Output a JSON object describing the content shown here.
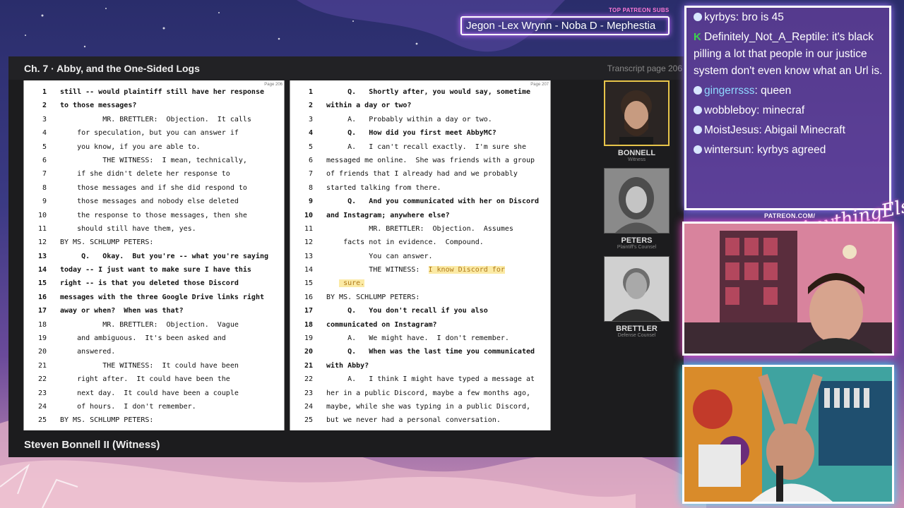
{
  "subs": {
    "label": "TOP PATREON SUBS",
    "names": "Jegon -Lex Wrynn -  Noba D - Mephestia"
  },
  "header": {
    "chapter": "Ch. 7  ·  Abby, and the One-Sided Logs",
    "transcript_page": "Transcript page 206"
  },
  "left_page": {
    "page_no": "Page 206",
    "lines": [
      {
        "n": "1",
        "t": "still -- would plaintiff still have her response",
        "b": true
      },
      {
        "n": "2",
        "t": "to those messages?",
        "b": true
      },
      {
        "n": "3",
        "t": "          MR. BRETTLER:  Objection.  It calls",
        "b": false
      },
      {
        "n": "4",
        "t": "    for speculation, but you can answer if",
        "b": false
      },
      {
        "n": "5",
        "t": "    you know, if you are able to.",
        "b": false
      },
      {
        "n": "6",
        "t": "          THE WITNESS:  I mean, technically,",
        "b": false
      },
      {
        "n": "7",
        "t": "    if she didn't delete her response to",
        "b": false
      },
      {
        "n": "8",
        "t": "    those messages and if she did respond to",
        "b": false
      },
      {
        "n": "9",
        "t": "    those messages and nobody else deleted",
        "b": false
      },
      {
        "n": "10",
        "t": "    the response to those messages, then she",
        "b": false
      },
      {
        "n": "11",
        "t": "    should still have them, yes.",
        "b": false
      },
      {
        "n": "12",
        "t": "BY MS. SCHLUMP PETERS:",
        "b": false
      },
      {
        "n": "13",
        "t": "     Q.   Okay.  But you're -- what you're saying",
        "b": true
      },
      {
        "n": "14",
        "t": "today -- I just want to make sure I have this",
        "b": true
      },
      {
        "n": "15",
        "t": "right -- is that you deleted those Discord",
        "b": true
      },
      {
        "n": "16",
        "t": "messages with the three Google Drive links right",
        "b": true
      },
      {
        "n": "17",
        "t": "away or when?  When was that?",
        "b": true
      },
      {
        "n": "18",
        "t": "          MR. BRETTLER:  Objection.  Vague",
        "b": false
      },
      {
        "n": "19",
        "t": "    and ambiguous.  It's been asked and",
        "b": false
      },
      {
        "n": "20",
        "t": "    answered.",
        "b": false
      },
      {
        "n": "21",
        "t": "          THE WITNESS:  It could have been",
        "b": false
      },
      {
        "n": "22",
        "t": "    right after.  It could have been the",
        "b": false
      },
      {
        "n": "23",
        "t": "    next day.  It could have been a couple",
        "b": false
      },
      {
        "n": "24",
        "t": "    of hours.  I don't remember.",
        "b": false
      },
      {
        "n": "25",
        "t": "BY MS. SCHLUMP PETERS:",
        "b": false
      }
    ]
  },
  "right_page": {
    "page_no": "Page 207",
    "lines": [
      {
        "n": "1",
        "t": "     Q.   Shortly after, you would say, sometime",
        "b": true
      },
      {
        "n": "2",
        "t": "within a day or two?",
        "b": true
      },
      {
        "n": "3",
        "t": "     A.   Probably within a day or two.",
        "b": false
      },
      {
        "n": "4",
        "t": "     Q.   How did you first meet AbbyMC?",
        "b": true
      },
      {
        "n": "5",
        "t": "     A.   I can't recall exactly.  I'm sure she",
        "b": false
      },
      {
        "n": "6",
        "t": "messaged me online.  She was friends with a group",
        "b": false
      },
      {
        "n": "7",
        "t": "of friends that I already had and we probably",
        "b": false
      },
      {
        "n": "8",
        "t": "started talking from there.",
        "b": false
      },
      {
        "n": "9",
        "t": "     Q.   And you communicated with her on Discord",
        "b": true
      },
      {
        "n": "10",
        "t": "and Instagram; anywhere else?",
        "b": true
      },
      {
        "n": "11",
        "t": "          MR. BRETTLER:  Objection.  Assumes",
        "b": false
      },
      {
        "n": "12",
        "t": "    facts not in evidence.  Compound.",
        "b": false
      },
      {
        "n": "13",
        "t": "          You can answer.",
        "b": false
      },
      {
        "n": "14",
        "t": "          THE WITNESS:  ",
        "b": false,
        "hl": "I know Discord for"
      },
      {
        "n": "15",
        "t": "   ",
        "b": false,
        "hl": " sure."
      },
      {
        "n": "16",
        "t": "BY MS. SCHLUMP PETERS:",
        "b": false
      },
      {
        "n": "17",
        "t": "     Q.   You don't recall if you also",
        "b": true
      },
      {
        "n": "18",
        "t": "communicated on Instagram?",
        "b": true
      },
      {
        "n": "19",
        "t": "     A.   We might have.  I don't remember.",
        "b": false
      },
      {
        "n": "20",
        "t": "     Q.   When was the last time you communicated",
        "b": true
      },
      {
        "n": "21",
        "t": "with Abby?",
        "b": true
      },
      {
        "n": "22",
        "t": "     A.   I think I might have typed a message at",
        "b": false
      },
      {
        "n": "23",
        "t": "her in a public Discord, maybe a few months ago,",
        "b": false
      },
      {
        "n": "24",
        "t": "maybe, while she was typing in a public Discord,",
        "b": false
      },
      {
        "n": "25",
        "t": "but we never had a personal conversation.",
        "b": false
      }
    ]
  },
  "people": [
    {
      "name": "BONNELL",
      "role": "Witness"
    },
    {
      "name": "PETERS",
      "role": "Plaintiff's Counsel"
    },
    {
      "name": "BRETTLER",
      "role": "Defense Counsel"
    }
  ],
  "footer": {
    "speaker": "Steven Bonnell II (Witness)"
  },
  "chat": [
    {
      "user": "kyrbys",
      "msg": " bro is 45",
      "badge": "dot"
    },
    {
      "user": "Definitely_Not_A_Reptile",
      "msg": " it's black pilling a lot that people in our justice system don't even know what an Url is.",
      "badge": "kick"
    },
    {
      "user": "gingerrsss",
      "msg": "  queen",
      "badge": "dot",
      "blue": true
    },
    {
      "user": "wobbleboy",
      "msg": " minecraf",
      "badge": "dot"
    },
    {
      "user": "MoistJesus",
      "msg": " Abigail Minecraft",
      "badge": "dot"
    },
    {
      "user": "wintersun",
      "msg": " kyrbys agreed",
      "badge": "dot"
    }
  ],
  "overlay": {
    "patreon": "PATREON.COM/",
    "logo": "AnythingElse"
  }
}
